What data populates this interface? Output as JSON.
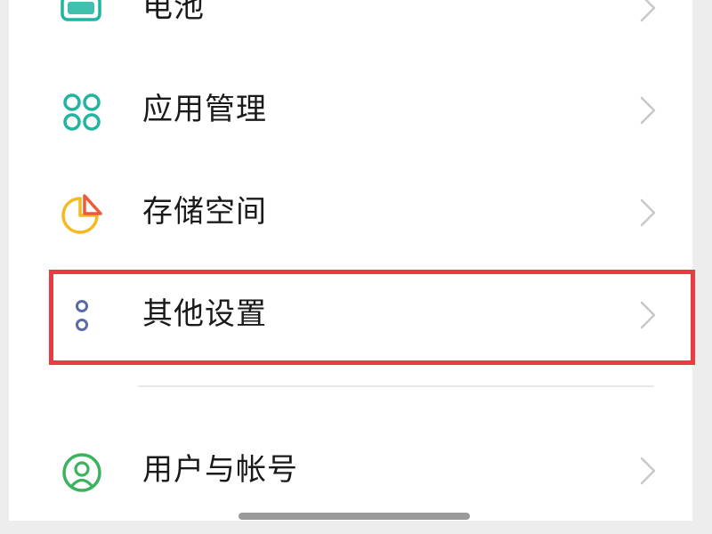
{
  "settings": {
    "items": [
      {
        "id": "battery",
        "label": "电池",
        "icon": "battery-icon",
        "icon_color": "#1fb5a0"
      },
      {
        "id": "apps",
        "label": "应用管理",
        "icon": "app-management-icon",
        "icon_color": "#1fb5a0"
      },
      {
        "id": "storage",
        "label": "存储空间",
        "icon": "storage-pie-icon",
        "icon_color": "#f5b921",
        "icon_accent": "#ef5a3a"
      },
      {
        "id": "other",
        "label": "其他设置",
        "icon": "other-settings-icon",
        "icon_color": "#5a6aa8"
      },
      {
        "id": "users",
        "label": "用户与帐号",
        "icon": "user-account-icon",
        "icon_color": "#3bb35e"
      }
    ]
  },
  "highlight": {
    "target": "other",
    "color": "#ea3b40"
  },
  "chevron_icon": "chevron-right-icon",
  "chevron_color": "#c8c8c8"
}
